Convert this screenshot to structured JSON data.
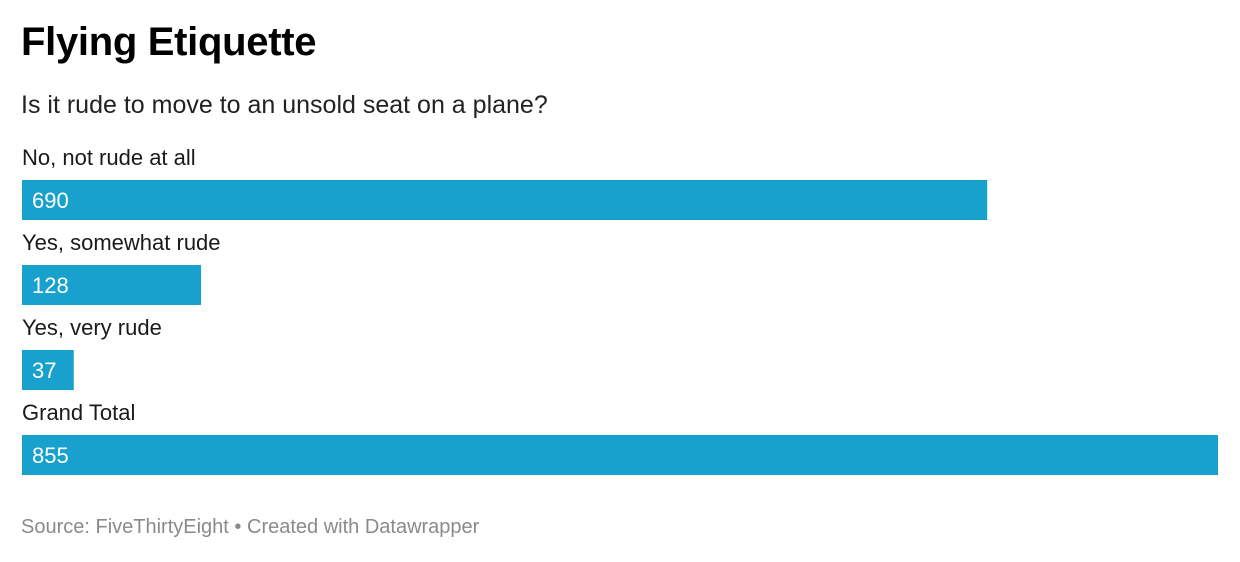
{
  "header": {
    "title": "Flying Etiquette",
    "subtitle": "Is it rude to move to an unsold seat on a plane?"
  },
  "footer": {
    "source_label": "Source: FiveThirtyEight",
    "separator": "•",
    "credit": "Created with Datawrapper"
  },
  "colors": {
    "bar": "#18a1cd",
    "label": "#1a1a1a",
    "value_label": "#ffffff"
  },
  "chart_data": {
    "type": "bar",
    "orientation": "horizontal",
    "categories": [
      "No, not rude at all",
      "Yes, somewhat rude",
      "Yes, very rude",
      "Grand Total"
    ],
    "values": [
      690,
      128,
      37,
      855
    ],
    "value_labels": [
      "690",
      "128",
      "37",
      "855"
    ],
    "xlim": [
      0,
      855
    ],
    "grid": false,
    "legend": "none"
  }
}
